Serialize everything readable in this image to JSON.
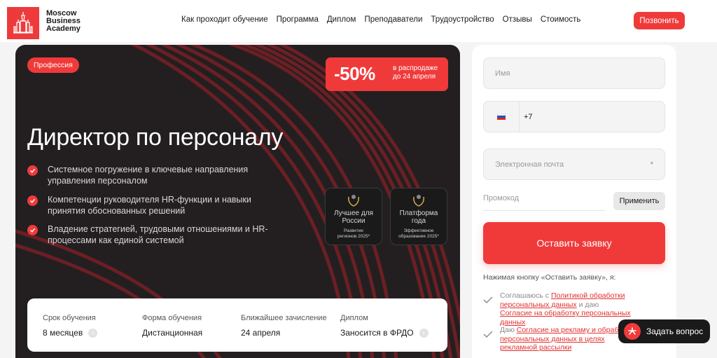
{
  "header": {
    "logo_lines": [
      "Moscow",
      "Business",
      "Academy"
    ],
    "nav": [
      "Как проходит обучение",
      "Программа",
      "Диплом",
      "Преподаватели",
      "Трудоустройство",
      "Отзывы",
      "Стоимость"
    ],
    "call_label": "Позвонить"
  },
  "hero": {
    "tag": "Профессия",
    "promo_percent": "-50%",
    "promo_lines": [
      "в распродаже",
      "до 24 апреля"
    ],
    "title": "Директор по персоналу",
    "benefits": [
      [
        "Системное погружение в ключевые направления",
        "управления персоналом"
      ],
      [
        "Компетенции руководителя HR-функции и навыки",
        "принятия обоснованных решений"
      ],
      [
        "Владение стратегией, трудовыми отношениями и HR-",
        "процессами как единой системой"
      ]
    ],
    "awards": [
      {
        "title": [
          "Лучшее для",
          "России"
        ],
        "sub": [
          "Развитие",
          "регионов 2025*"
        ]
      },
      {
        "title": [
          "Платформа",
          "года"
        ],
        "sub": [
          "Эффективное",
          "образование 2025*"
        ]
      }
    ],
    "info": [
      {
        "label": "Срок обучения",
        "value": "8 месяцев",
        "has_info": true
      },
      {
        "label": "Форма обучения",
        "value": "Дистанционная",
        "has_info": false
      },
      {
        "label": "Ближайшее зачисление",
        "value": "24 апреля",
        "has_info": false
      },
      {
        "label": "Диплом",
        "value": "Заносится в ФРДО",
        "has_info": true
      }
    ],
    "info_icon": "i"
  },
  "form": {
    "name_placeholder": "Имя",
    "phone_code": "+7",
    "email_placeholder": "Электронная почта",
    "required_mark": "*",
    "promo_placeholder": "Промокод",
    "apply_label": "Применить",
    "submit_label": "Оставить заявку",
    "consent_hint": "Нажимая кнопку «Оставить заявку», я:",
    "consent1": {
      "before": "Соглашаюсь с ",
      "link1": "Политикой обработки персональных данных",
      "middle": " и даю ",
      "link2": "Согласие на обработку персональных данных"
    },
    "consent2": {
      "before": "Даю ",
      "link1": "Согласие на рекламу и обработ",
      "link2": "персональных данных в целях рекламной рассылки"
    }
  },
  "chat": {
    "label": "Задать вопрос"
  },
  "colors": {
    "accent": "#f03a3a",
    "hero_bg": "#231f20"
  }
}
